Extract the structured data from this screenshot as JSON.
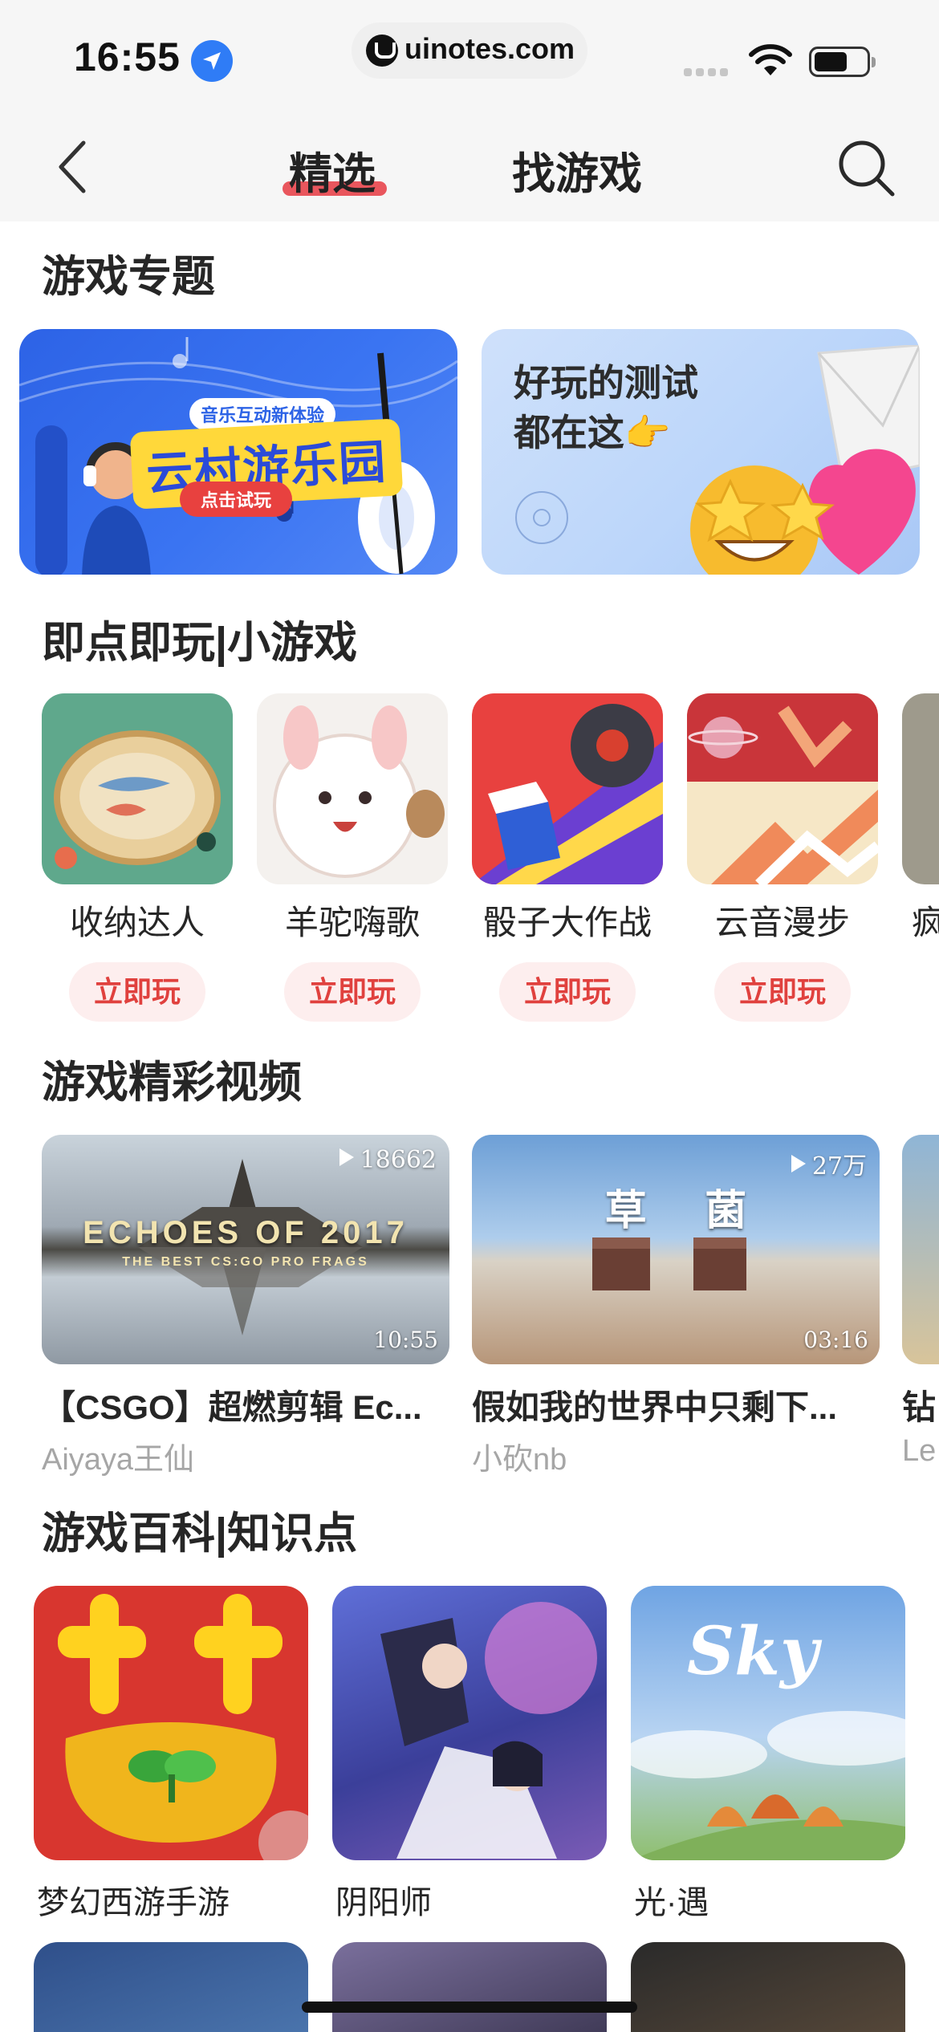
{
  "status_bar": {
    "time": "16:55",
    "url": "uinotes.com"
  },
  "nav": {
    "tabs": [
      {
        "label": "精选",
        "active": true
      },
      {
        "label": "找游戏",
        "active": false
      }
    ]
  },
  "sections": {
    "topics": {
      "title": "游戏专题",
      "banners": [
        {
          "kicker": "音乐互动新体验",
          "title": "云村游乐园",
          "button": "点击试玩"
        },
        {
          "title_line1": "好玩的测试",
          "title_line2": "都在这👉"
        }
      ]
    },
    "mini_games": {
      "title": "即点即玩|小游戏",
      "play_label": "立即玩",
      "items": [
        {
          "name": "收纳达人"
        },
        {
          "name": "羊驼嗨歌"
        },
        {
          "name": "骰子大作战"
        },
        {
          "name": "云音漫步"
        },
        {
          "name": "疯"
        }
      ]
    },
    "videos": {
      "title": "游戏精彩视频",
      "items": [
        {
          "title": "【CSGO】超燃剪辑 Ec...",
          "author": "Aiyaya王仙",
          "views": "18662",
          "duration": "10:55",
          "overlay_text": "ECHOES OF 2017",
          "overlay_sub": "THE BEST CS:GO PRO FRAGS"
        },
        {
          "title": "假如我的世界中只剩下...",
          "author": "小砍nb",
          "views": "27万",
          "duration": "03:16",
          "overlay_text": "草    菌"
        },
        {
          "title": "钻",
          "author": "Le"
        }
      ]
    },
    "wiki": {
      "title": "游戏百科|知识点",
      "items": [
        {
          "name": "梦幻西游手游"
        },
        {
          "name": "阴阳师"
        },
        {
          "name": "光·遇"
        }
      ]
    }
  },
  "colors": {
    "accent": "#e0413e",
    "play_bg": "#fdeeee",
    "page_bg": "#ffffff",
    "nav_bg": "#f6f6f6"
  }
}
